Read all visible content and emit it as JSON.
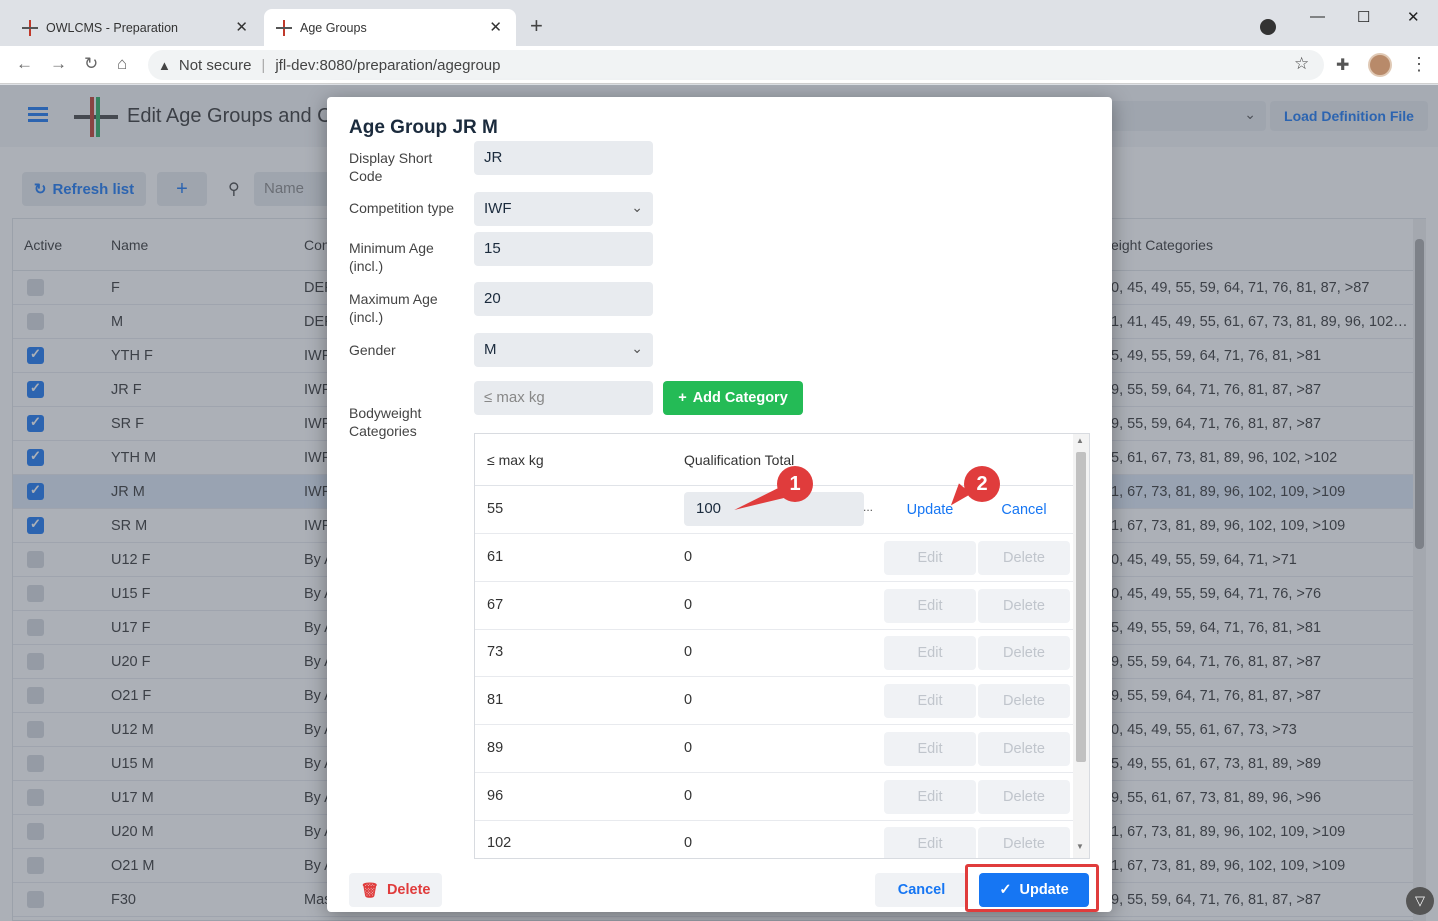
{
  "browser": {
    "tabs": [
      {
        "title": "OWLCMS - Preparation",
        "active": false
      },
      {
        "title": "Age Groups",
        "active": true
      }
    ],
    "new_tab": "+",
    "security": "Not secure",
    "url": "jfl-dev:8080/preparation/agegroup"
  },
  "header": {
    "title": "Edit Age Groups and C",
    "load_definition": "Load Definition File"
  },
  "toolbar": {
    "refresh": "Refresh list",
    "add": "+",
    "name_placeholder": "Name"
  },
  "grid": {
    "columns": [
      "Active",
      "Name",
      "Con",
      "eight Categories"
    ],
    "rows": [
      {
        "active": false,
        "name": "F",
        "comp": "DEF",
        "cats": "0, 45, 49, 55, 59, 64, 71, 76, 81, 87, >87"
      },
      {
        "active": false,
        "name": "M",
        "comp": "DEF",
        "cats": "1, 41, 45, 49, 55, 61, 67, 73, 81, 89, 96, 102, ..."
      },
      {
        "active": true,
        "name": "YTH F",
        "comp": "IWF",
        "cats": "5, 49, 55, 59, 64, 71, 76, 81, >81"
      },
      {
        "active": true,
        "name": "JR F",
        "comp": "IWF",
        "cats": "9, 55, 59, 64, 71, 76, 81, 87, >87"
      },
      {
        "active": true,
        "name": "SR F",
        "comp": "IWF",
        "cats": "9, 55, 59, 64, 71, 76, 81, 87, >87"
      },
      {
        "active": true,
        "name": "YTH M",
        "comp": "IWF",
        "cats": "5, 61, 67, 73, 81, 89, 96, 102, >102"
      },
      {
        "active": true,
        "name": "JR M",
        "comp": "IWF",
        "cats": "1, 67, 73, 81, 89, 96, 102, 109, >109",
        "selected": true
      },
      {
        "active": true,
        "name": "SR M",
        "comp": "IWF",
        "cats": "1, 67, 73, 81, 89, 96, 102, 109, >109"
      },
      {
        "active": false,
        "name": "U12 F",
        "comp": "By A",
        "cats": "0, 45, 49, 55, 59, 64, 71, >71"
      },
      {
        "active": false,
        "name": "U15 F",
        "comp": "By A",
        "cats": "0, 45, 49, 55, 59, 64, 71, 76, >76"
      },
      {
        "active": false,
        "name": "U17 F",
        "comp": "By A",
        "cats": "5, 49, 55, 59, 64, 71, 76, 81, >81"
      },
      {
        "active": false,
        "name": "U20 F",
        "comp": "By A",
        "cats": "9, 55, 59, 64, 71, 76, 81, 87, >87"
      },
      {
        "active": false,
        "name": "O21 F",
        "comp": "By A",
        "cats": "9, 55, 59, 64, 71, 76, 81, 87, >87"
      },
      {
        "active": false,
        "name": "U12 M",
        "comp": "By A",
        "cats": "0, 45, 49, 55, 61, 67, 73, >73"
      },
      {
        "active": false,
        "name": "U15 M",
        "comp": "By A",
        "cats": "5, 49, 55, 61, 67, 73, 81, 89, >89"
      },
      {
        "active": false,
        "name": "U17 M",
        "comp": "By A",
        "cats": "9, 55, 61, 67, 73, 81, 89, 96, >96"
      },
      {
        "active": false,
        "name": "U20 M",
        "comp": "By A",
        "cats": "1, 67, 73, 81, 89, 96, 102, 109, >109"
      },
      {
        "active": false,
        "name": "O21 M",
        "comp": "By A",
        "cats": "1, 67, 73, 81, 89, 96, 102, 109, >109"
      },
      {
        "active": false,
        "name": "F30",
        "comp": "Mas",
        "cats": "9, 55, 59, 64, 71, 76, 81, 87, >87"
      }
    ]
  },
  "dialog": {
    "title": "Age Group JR M",
    "labels": {
      "short_code": "Display Short Code",
      "competition_type": "Competition type",
      "min_age": "Minimum Age (incl.)",
      "max_age": "Maximum Age (incl.)",
      "gender": "Gender",
      "bw_categories": "Bodyweight Categories"
    },
    "values": {
      "short_code": "JR",
      "competition_type": "IWF",
      "min_age": "15",
      "max_age": "20",
      "gender": "M"
    },
    "new_cat_placeholder": "≤ max kg",
    "add_category": "Add Category",
    "table": {
      "col_kg": "≤ max kg",
      "col_qual": "Qualification Total",
      "editing": {
        "kg": "55",
        "qual": "100",
        "update": "Update",
        "cancel": "Cancel",
        "ellipsis": "..."
      },
      "rows": [
        {
          "kg": "61",
          "qual": "0"
        },
        {
          "kg": "67",
          "qual": "0"
        },
        {
          "kg": "73",
          "qual": "0"
        },
        {
          "kg": "81",
          "qual": "0"
        },
        {
          "kg": "89",
          "qual": "0"
        },
        {
          "kg": "96",
          "qual": "0"
        },
        {
          "kg": "102",
          "qual": "0"
        }
      ],
      "edit": "Edit",
      "delete": "Delete"
    },
    "footer": {
      "delete": "Delete",
      "cancel": "Cancel",
      "update": "Update"
    }
  },
  "annotations": {
    "marker1": "1",
    "marker2": "2",
    "color": "#e03c3c"
  },
  "accent": "#1676f3"
}
